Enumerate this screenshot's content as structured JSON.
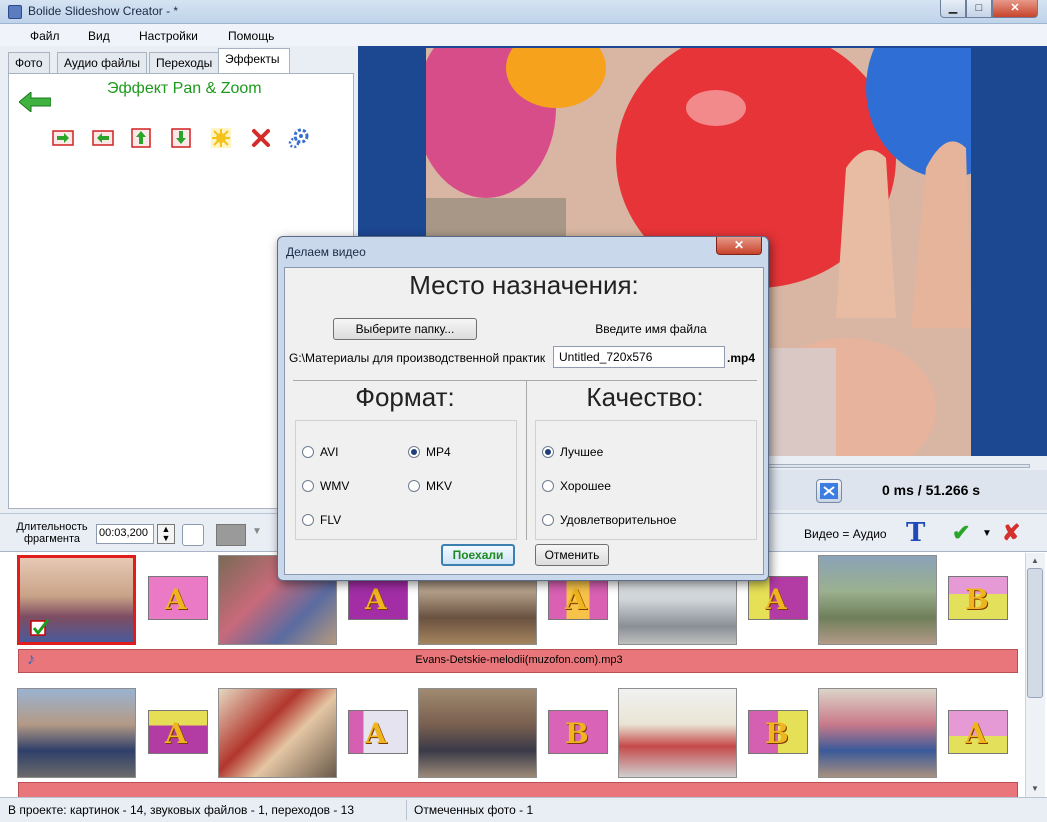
{
  "window": {
    "title": "Bolide Slideshow Creator - *",
    "minimize": "▁",
    "maximize": "□",
    "close": "✕"
  },
  "menu": [
    "Файл",
    "Вид",
    "Настройки",
    "Помощь"
  ],
  "tabs": [
    "Фото",
    "Аудио файлы",
    "Переходы",
    "Эффекты"
  ],
  "effects": {
    "title": "Эффект Pan & Zoom",
    "tools": [
      "move-right-icon",
      "move-left-icon",
      "move-up-icon",
      "move-down-icon",
      "star-burst-icon",
      "delete-icon",
      "settings-gear-icon"
    ]
  },
  "preview": {
    "time": "0 ms   / 51.266 s"
  },
  "toolbar": {
    "duration_label": "Длительность фрагмента",
    "duration_value": "00:03,200",
    "video_audio": "Видео = Аудио",
    "text_icon": "T",
    "check_icon": "✔",
    "dropdown_arrow": "▼",
    "swatch_arrow": "▼",
    "cancel_icon": "✘"
  },
  "storyboard": {
    "audio_track": "Evans-Detskie-melodii(muzofon.com).mp3",
    "note_icon": "♪",
    "scroll_up": "▲",
    "scroll_down": "▼",
    "transition_letters_row1": [
      "A",
      "A",
      "A",
      "A",
      "B",
      "A",
      "A"
    ],
    "transition_letters_row2": [
      "A",
      "A",
      "B",
      "B",
      "A",
      "A",
      "A"
    ]
  },
  "status": {
    "left": "В проекте: картинок - 14, звуковых файлов - 1, переходов - 13",
    "right": "Отмеченных фото - 1"
  },
  "dialog": {
    "title": "Делаем видео",
    "close": "✕",
    "destination_title": "Место назначения:",
    "choose_folder": "Выберите папку...",
    "filename_label": "Введите имя файла",
    "path": "G:\\Материалы для производственной практик",
    "filename_value": "Untitled_720x576",
    "extension": ".mp4",
    "format_title": "Формат:",
    "quality_title": "Качество:",
    "formats": [
      "AVI",
      "MP4",
      "WMV",
      "MKV",
      "FLV"
    ],
    "selected_format": "MP4",
    "qualities": [
      "Лучшее",
      "Хорошее",
      "Удовлетворительное"
    ],
    "selected_quality": "Лучшее",
    "go_button": "Поехали",
    "cancel_button": "Отменить"
  }
}
